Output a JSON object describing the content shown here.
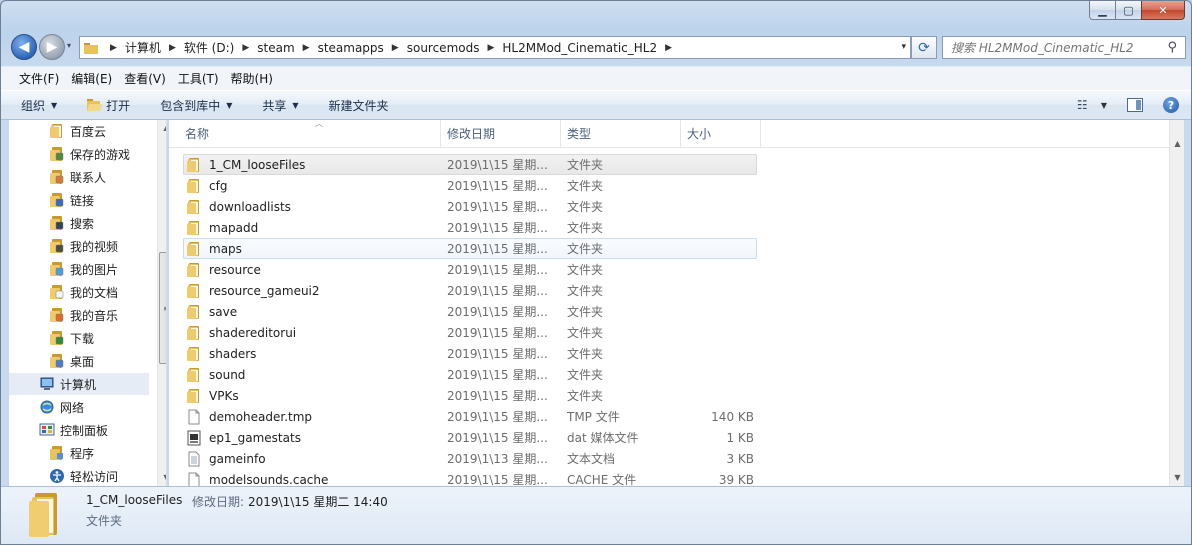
{
  "window": {
    "minimize": "▁",
    "maximize": "▢",
    "close": "✕"
  },
  "nav": {
    "back": "◀",
    "forward": "▶",
    "history_dropdown": "▾"
  },
  "address": {
    "crumbs": [
      "计算机",
      "软件 (D:)",
      "steam",
      "steamapps",
      "sourcemods",
      "HL2MMod_Cinematic_HL2"
    ],
    "separator": "▶",
    "dropdown": "▾",
    "refresh": "⟳"
  },
  "search": {
    "placeholder": "搜索 HL2MMod_Cinematic_HL2",
    "icon": "⚲"
  },
  "menubar": [
    "文件(F)",
    "编辑(E)",
    "查看(V)",
    "工具(T)",
    "帮助(H)"
  ],
  "commands": {
    "organize": "组织",
    "open": "打开",
    "include_library": "包含到库中",
    "share": "共享",
    "new_folder": "新建文件夹",
    "caret": "▼",
    "view_icon": "☷",
    "help": "?"
  },
  "navpane": {
    "items": [
      {
        "label": "百度云",
        "icon": "folder-icon",
        "indent": 1
      },
      {
        "label": "保存的游戏",
        "icon": "saved-games-icon",
        "indent": 1
      },
      {
        "label": "联系人",
        "icon": "contacts-icon",
        "indent": 1
      },
      {
        "label": "链接",
        "icon": "links-icon",
        "indent": 1
      },
      {
        "label": "搜索",
        "icon": "searches-icon",
        "indent": 1
      },
      {
        "label": "我的视频",
        "icon": "videos-icon",
        "indent": 1
      },
      {
        "label": "我的图片",
        "icon": "pictures-icon",
        "indent": 1
      },
      {
        "label": "我的文档",
        "icon": "documents-icon",
        "indent": 1
      },
      {
        "label": "我的音乐",
        "icon": "music-icon",
        "indent": 1
      },
      {
        "label": "下载",
        "icon": "downloads-icon",
        "indent": 1
      },
      {
        "label": "桌面",
        "icon": "desktop-icon",
        "indent": 1
      },
      {
        "label": "计算机",
        "icon": "computer-icon",
        "indent": 0,
        "selected": true
      },
      {
        "label": "网络",
        "icon": "network-icon",
        "indent": 0
      },
      {
        "label": "控制面板",
        "icon": "control-panel-icon",
        "indent": 0
      },
      {
        "label": "程序",
        "icon": "programs-icon",
        "indent": 1
      },
      {
        "label": "轻松访问",
        "icon": "ease-of-access-icon",
        "indent": 1
      }
    ],
    "scroll_up": "▲",
    "scroll_down": "▼",
    "thumb_grip": "≡"
  },
  "columns": {
    "name": "名称",
    "date": "修改日期",
    "type": "类型",
    "size": "大小",
    "sort_arrow": "︿"
  },
  "files": [
    {
      "name": "1_CM_looseFiles",
      "date": "2019\\1\\15 星期...",
      "type": "文件夹",
      "size": "",
      "kind": "folder",
      "state": "selected"
    },
    {
      "name": "cfg",
      "date": "2019\\1\\15 星期...",
      "type": "文件夹",
      "size": "",
      "kind": "folder"
    },
    {
      "name": "downloadlists",
      "date": "2019\\1\\15 星期...",
      "type": "文件夹",
      "size": "",
      "kind": "folder"
    },
    {
      "name": "mapadd",
      "date": "2019\\1\\15 星期...",
      "type": "文件夹",
      "size": "",
      "kind": "folder"
    },
    {
      "name": "maps",
      "date": "2019\\1\\15 星期...",
      "type": "文件夹",
      "size": "",
      "kind": "folder",
      "state": "hover"
    },
    {
      "name": "resource",
      "date": "2019\\1\\15 星期...",
      "type": "文件夹",
      "size": "",
      "kind": "folder"
    },
    {
      "name": "resource_gameui2",
      "date": "2019\\1\\15 星期...",
      "type": "文件夹",
      "size": "",
      "kind": "folder"
    },
    {
      "name": "save",
      "date": "2019\\1\\15 星期...",
      "type": "文件夹",
      "size": "",
      "kind": "folder"
    },
    {
      "name": "shadereditorui",
      "date": "2019\\1\\15 星期...",
      "type": "文件夹",
      "size": "",
      "kind": "folder"
    },
    {
      "name": "shaders",
      "date": "2019\\1\\15 星期...",
      "type": "文件夹",
      "size": "",
      "kind": "folder"
    },
    {
      "name": "sound",
      "date": "2019\\1\\15 星期...",
      "type": "文件夹",
      "size": "",
      "kind": "folder"
    },
    {
      "name": "VPKs",
      "date": "2019\\1\\15 星期...",
      "type": "文件夹",
      "size": "",
      "kind": "folder"
    },
    {
      "name": "demoheader.tmp",
      "date": "2019\\1\\15 星期...",
      "type": "TMP 文件",
      "size": "140 KB",
      "kind": "file"
    },
    {
      "name": "ep1_gamestats",
      "date": "2019\\1\\15 星期...",
      "type": "dat 媒体文件",
      "size": "1 KB",
      "kind": "media"
    },
    {
      "name": "gameinfo",
      "date": "2019\\1\\13 星期...",
      "type": "文本文档",
      "size": "3 KB",
      "kind": "text"
    },
    {
      "name": "modelsounds.cache",
      "date": "2019\\1\\15 星期...",
      "type": "CACHE 文件",
      "size": "39 KB",
      "kind": "file"
    }
  ],
  "list_scroll": {
    "up": "▲",
    "down": "▼"
  },
  "details": {
    "name": "1_CM_looseFiles",
    "date_label": "修改日期:",
    "date": "2019\\1\\15 星期二 14:40",
    "type": "文件夹"
  },
  "colors": {
    "folder": "#e8c25a",
    "folder_dark": "#c99a2e",
    "accent": "#2f65b8"
  }
}
